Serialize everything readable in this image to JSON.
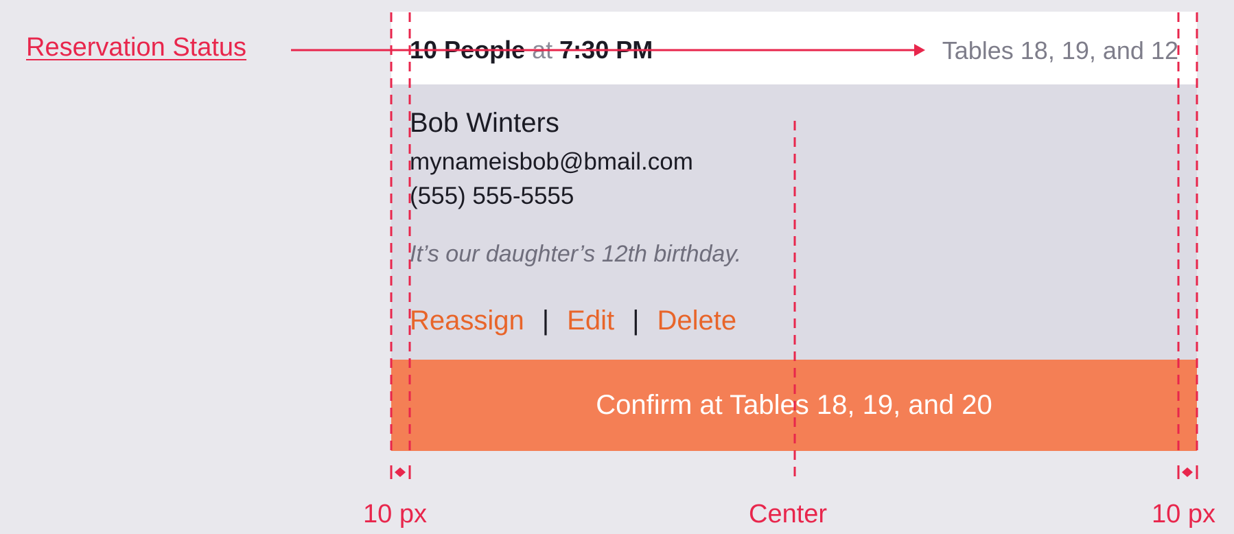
{
  "reservation": {
    "party_size": "10 People",
    "at_word": "at",
    "time": "7:30 PM",
    "assigned_tables": "Tables 18, 19, and 12",
    "guest": {
      "name": "Bob Winters",
      "email": "mynameisbob@bmail.com",
      "phone": "(555) 555-5555",
      "note": "It’s our daughter’s 12th birthday."
    },
    "actions": {
      "reassign": "Reassign",
      "edit": "Edit",
      "delete": "Delete",
      "separator": "|"
    },
    "confirm_label": "Confirm at Tables 18, 19, and 20"
  },
  "annotations": {
    "status_label": "Reservation Status",
    "left_padding": "10 px",
    "center": "Center",
    "right_padding": "10 px",
    "color": "#e8264c"
  },
  "colors": {
    "background": "#e9e8ed",
    "header_bg": "#ffffff",
    "body_bg": "#dcdbe4",
    "confirm_bg": "#f47f55",
    "action_link": "#e8652a"
  }
}
